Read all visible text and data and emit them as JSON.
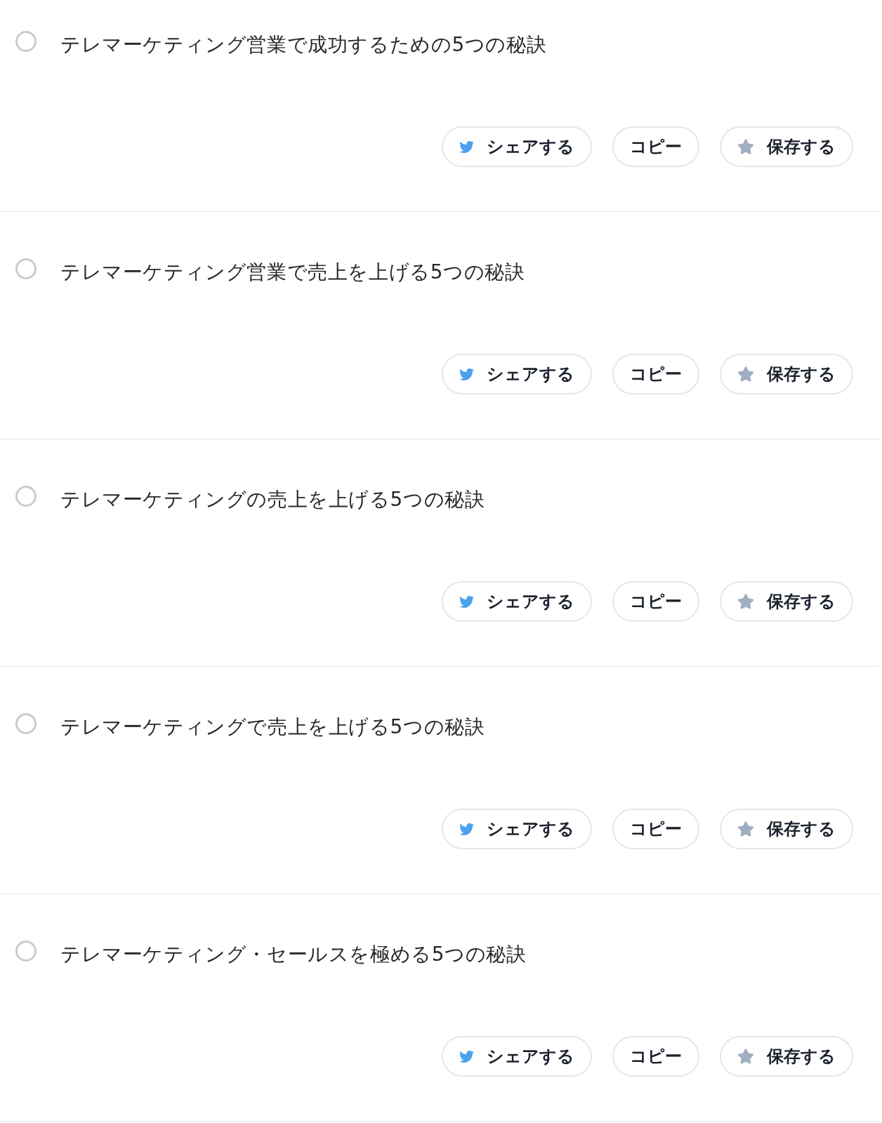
{
  "items": [
    {
      "title": "テレマーケティング営業で成功するための5つの秘訣",
      "selected": false,
      "actions": [
        {
          "kind": "share",
          "label": "シェアする"
        },
        {
          "kind": "copy",
          "label": "コピー"
        },
        {
          "kind": "save",
          "label": "保存する"
        }
      ]
    },
    {
      "title": "テレマーケティング営業で売上を上げる5つの秘訣",
      "selected": false,
      "actions": [
        {
          "kind": "share",
          "label": "シェアする"
        },
        {
          "kind": "copy",
          "label": "コピー"
        },
        {
          "kind": "save",
          "label": "保存する"
        }
      ]
    },
    {
      "title": "テレマーケティングの売上を上げる5つの秘訣",
      "selected": false,
      "actions": [
        {
          "kind": "share",
          "label": "シェアする"
        },
        {
          "kind": "copy",
          "label": "コピー"
        },
        {
          "kind": "save",
          "label": "保存する"
        }
      ]
    },
    {
      "title": "テレマーケティングで売上を上げる5つの秘訣",
      "selected": false,
      "actions": [
        {
          "kind": "share",
          "label": "シェアする"
        },
        {
          "kind": "copy",
          "label": "コピー"
        },
        {
          "kind": "save",
          "label": "保存する"
        }
      ]
    },
    {
      "title": "テレマーケティング・セールスを極める5つの秘訣",
      "selected": false,
      "actions": [
        {
          "kind": "share",
          "label": "シェアする"
        },
        {
          "kind": "copy",
          "label": "コピー"
        },
        {
          "kind": "save",
          "label": "保存する"
        }
      ]
    }
  ]
}
